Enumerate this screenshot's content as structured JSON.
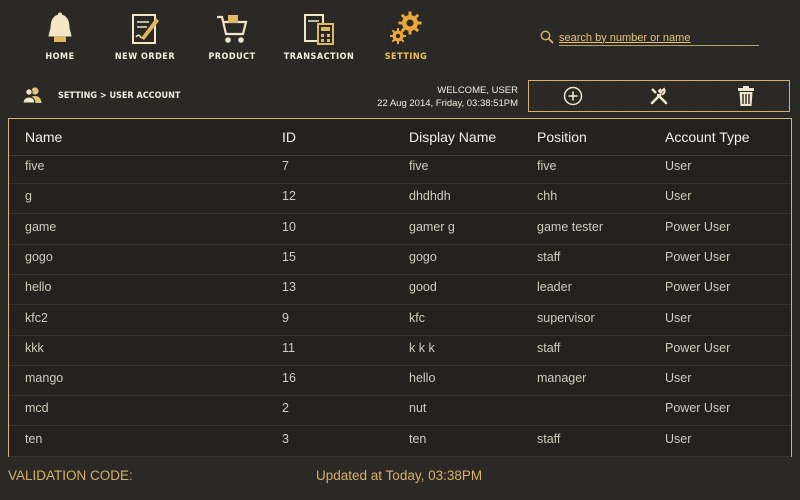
{
  "nav": {
    "items": [
      {
        "label": "HOME",
        "icon": "home-bell-icon"
      },
      {
        "label": "NEW ORDER",
        "icon": "new-order-icon"
      },
      {
        "label": "PRODUCT",
        "icon": "cart-icon"
      },
      {
        "label": "TRANSACTION",
        "icon": "calculator-icon"
      },
      {
        "label": "SETTING",
        "icon": "gear-icon",
        "active": true
      }
    ]
  },
  "search": {
    "placeholder": "search by number or name",
    "value": ""
  },
  "breadcrumb": {
    "text": "SETTING > USER ACCOUNT",
    "icon": "users-icon"
  },
  "welcome": {
    "greeting": "WELCOME, USER",
    "datetime": "22 Aug 2014, Friday, 03:38:51PM"
  },
  "toolbar": {
    "add_icon": "add-icon",
    "edit_icon": "tools-icon",
    "delete_icon": "trash-icon"
  },
  "table": {
    "headers": [
      "Name",
      "ID",
      "Display Name",
      "Position",
      "Account Type"
    ],
    "rows": [
      [
        "five",
        "7",
        "five",
        "five",
        "User"
      ],
      [
        "g",
        "12",
        "dhdhdh",
        "chh",
        "User"
      ],
      [
        "game",
        "10",
        "gamer g",
        "game tester",
        "Power User"
      ],
      [
        "gogo",
        "15",
        "gogo",
        "staff",
        "Power User"
      ],
      [
        "hello",
        "13",
        "good",
        "leader",
        "Power User"
      ],
      [
        "kfc2",
        "9",
        "kfc",
        "supervisor",
        "User"
      ],
      [
        "kkk",
        "11",
        "k k k",
        "staff",
        "Power User"
      ],
      [
        "mango",
        "16",
        "hello",
        "manager",
        "User"
      ],
      [
        "mcd",
        "2",
        "nut",
        "",
        "Power User"
      ],
      [
        "ten",
        "3",
        "ten",
        "staff",
        "User"
      ]
    ]
  },
  "footer": {
    "validation_label": "VALIDATION CODE:",
    "updated": "Updated at Today, 03:38PM"
  },
  "colors": {
    "accent": "#d8b066",
    "background": "#2a2824",
    "active_nav": "#f0c060"
  }
}
